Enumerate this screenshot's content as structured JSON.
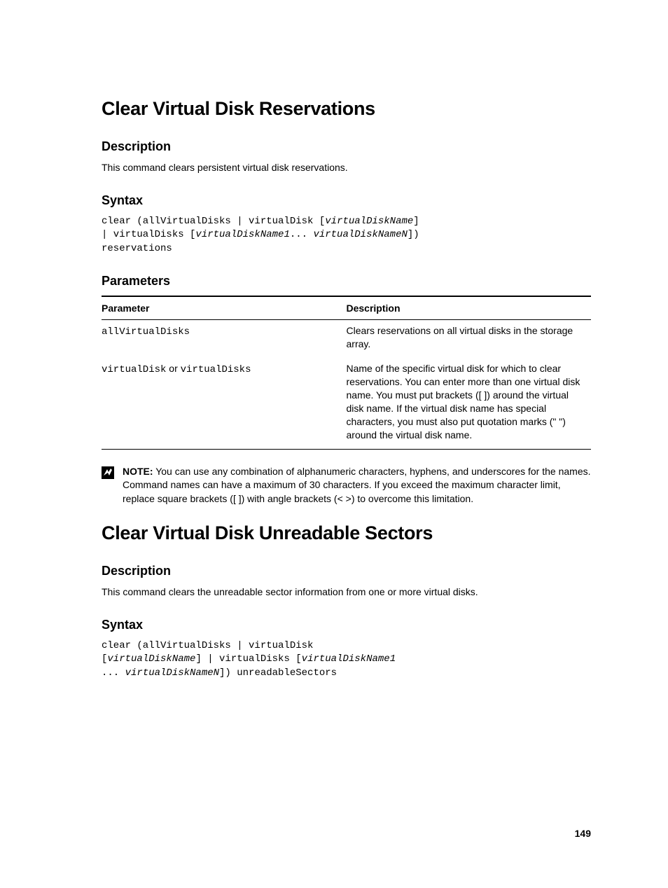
{
  "page_number": "149",
  "sections": [
    {
      "heading": "Clear Virtual Disk Reservations",
      "subs": [
        {
          "title": "Description",
          "body": "This command clears persistent virtual disk reservations."
        },
        {
          "title": "Syntax",
          "code_lines": [
            [
              {
                "t": "clear (allVirtualDisks | virtualDisk [",
                "i": false
              },
              {
                "t": "virtualDiskName",
                "i": true
              },
              {
                "t": "]",
                "i": false
              }
            ],
            [
              {
                "t": "| virtualDisks [",
                "i": false
              },
              {
                "t": "virtualDiskName1",
                "i": true
              },
              {
                "t": "... ",
                "i": false
              },
              {
                "t": "virtualDiskNameN",
                "i": true
              },
              {
                "t": "])",
                "i": false
              }
            ],
            [
              {
                "t": "reservations",
                "i": false
              }
            ]
          ]
        },
        {
          "title": "Parameters",
          "table": {
            "headers": [
              "Parameter",
              "Description"
            ],
            "rows": [
              {
                "param_segments": [
                  {
                    "t": "allVirtualDisks",
                    "mono": true
                  }
                ],
                "desc": "Clears reservations on all virtual disks in the storage array."
              },
              {
                "param_segments": [
                  {
                    "t": "virtualDisk",
                    "mono": true
                  },
                  {
                    "t": " or ",
                    "mono": false
                  },
                  {
                    "t": "virtualDisks",
                    "mono": true
                  }
                ],
                "desc": "Name of the specific virtual disk for which to clear reservations. You can enter more than one virtual disk name. You must put brackets ([ ]) around the virtual disk name. If the virtual disk name has special characters, you must also put quotation marks (\" \") around the virtual disk name."
              }
            ]
          },
          "note": {
            "label": "NOTE:",
            "text": " You can use any combination of alphanumeric characters, hyphens, and underscores for the names. Command names can have a maximum of 30 characters. If you exceed the maximum character limit, replace square brackets ([ ]) with angle brackets (< >) to overcome this limitation."
          }
        }
      ]
    },
    {
      "heading": "Clear Virtual Disk Unreadable Sectors",
      "subs": [
        {
          "title": "Description",
          "body": "This command clears the unreadable sector information from one or more virtual disks."
        },
        {
          "title": "Syntax",
          "code_lines": [
            [
              {
                "t": "clear (allVirtualDisks | virtualDisk",
                "i": false
              }
            ],
            [
              {
                "t": "[",
                "i": false
              },
              {
                "t": "virtualDiskName",
                "i": true
              },
              {
                "t": "] | virtualDisks [",
                "i": false
              },
              {
                "t": "virtualDiskName1",
                "i": true
              }
            ],
            [
              {
                "t": "... ",
                "i": false
              },
              {
                "t": "virtualDiskNameN",
                "i": true
              },
              {
                "t": "]) unreadableSectors",
                "i": false
              }
            ]
          ]
        }
      ]
    }
  ]
}
